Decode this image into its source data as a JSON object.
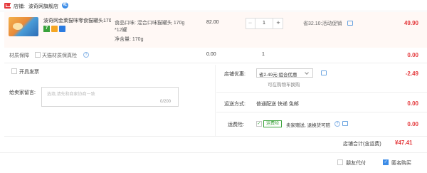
{
  "shop": {
    "label": "店铺:",
    "name": "波奇网旗舰店",
    "ww_icon": "wangwang-chat-icon"
  },
  "item": {
    "title": "波奇网金莱猫咪零食猫罐头170...",
    "tags": [
      "7",
      "",
      ""
    ],
    "sku_line1": "食品口味: 混合口味猫罐头 170g",
    "sku_line2": "*12罐",
    "sku_line3": "净含量: 170g",
    "price": "82.00",
    "qty": "1",
    "minus": "−",
    "plus": "+",
    "promo": "省32.10:活动促销",
    "subtotal": "49.90"
  },
  "insurance": {
    "label": "材质保障",
    "text": "天猫材质保真险",
    "price": "0.00",
    "qty": "1",
    "subtotal": "0.00"
  },
  "invoice": {
    "label": "开具发票"
  },
  "message": {
    "label": "给卖家留言:",
    "placeholder": "选填,请先和商家协商一致",
    "count": "0/200"
  },
  "discount": {
    "label": "店铺优惠:",
    "selected": "省2.49元:组合优惠",
    "sub": "可在购物车换购",
    "value": "-2.49"
  },
  "shipping": {
    "label": "运送方式:",
    "method": "普通配送 快递 免邮",
    "value": "0.00"
  },
  "freight_insurance": {
    "label": "运费险:",
    "badge": "运费险",
    "desc": "卖家赠送, 退换货可赔",
    "value": "0.00"
  },
  "store_total": {
    "label": "店铺合计(含运费)",
    "value": "¥47.41"
  },
  "footer": {
    "friend_pay": "朋友代付",
    "anonymous": "匿名购买",
    "anonymous_checked": true
  },
  "colors": {
    "accent_red": "#e4393c",
    "link_blue": "#3c8ce7"
  }
}
